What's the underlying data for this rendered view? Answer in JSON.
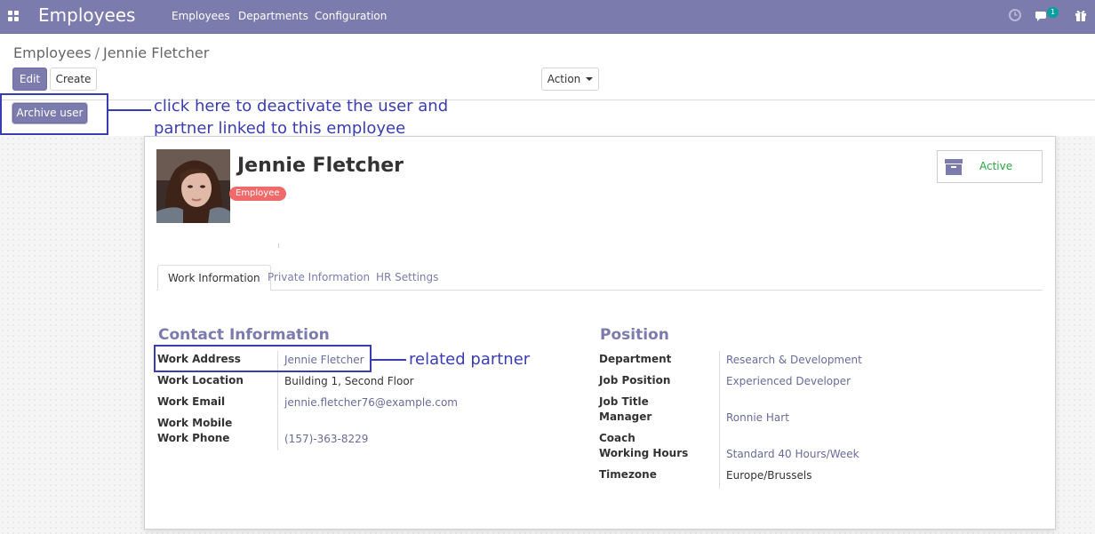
{
  "navbar": {
    "app_title": "Employees",
    "menu": [
      "Employees",
      "Departments",
      "Configuration"
    ],
    "chat_count": "1",
    "colors": {
      "bar": "#7c7bad",
      "badge": "#00a09d"
    }
  },
  "breadcrumb": {
    "parent": "Employees",
    "separator": "/",
    "current": "Jennie Fletcher"
  },
  "buttons": {
    "edit": "Edit",
    "create": "Create",
    "action": "Action",
    "archive_user": "Archive user"
  },
  "annotations": {
    "archive_note_line1": "click here to deactivate the user and",
    "archive_note_line2": "partner linked to this employee",
    "partner_note": "related partner",
    "color": "#3a3db0"
  },
  "employee": {
    "name": "Jennie Fletcher",
    "tag": "Employee",
    "status_button": "Active"
  },
  "tabs": [
    "Work Information",
    "Private Information",
    "HR Settings"
  ],
  "contact": {
    "title": "Contact Information",
    "fields": [
      {
        "label": "Work Address",
        "value": "Jennie Fletcher"
      },
      {
        "label": "Work Location",
        "value": "Building 1, Second Floor"
      },
      {
        "label": "Work Email",
        "value": "jennie.fletcher76@example.com"
      },
      {
        "label": "Work Mobile",
        "value": ""
      },
      {
        "label": "Work Phone",
        "value": "(157)-363-8229"
      }
    ]
  },
  "position": {
    "title": "Position",
    "fields": [
      {
        "label": "Department",
        "value": "Research & Development"
      },
      {
        "label": "Job Position",
        "value": "Experienced Developer"
      },
      {
        "label": "Job Title",
        "value": ""
      },
      {
        "label": "Manager",
        "value": "Ronnie Hart"
      },
      {
        "label": "Coach",
        "value": ""
      },
      {
        "label": "Working Hours",
        "value": "Standard 40 Hours/Week"
      },
      {
        "label": "Timezone",
        "value": "Europe/Brussels"
      }
    ]
  }
}
